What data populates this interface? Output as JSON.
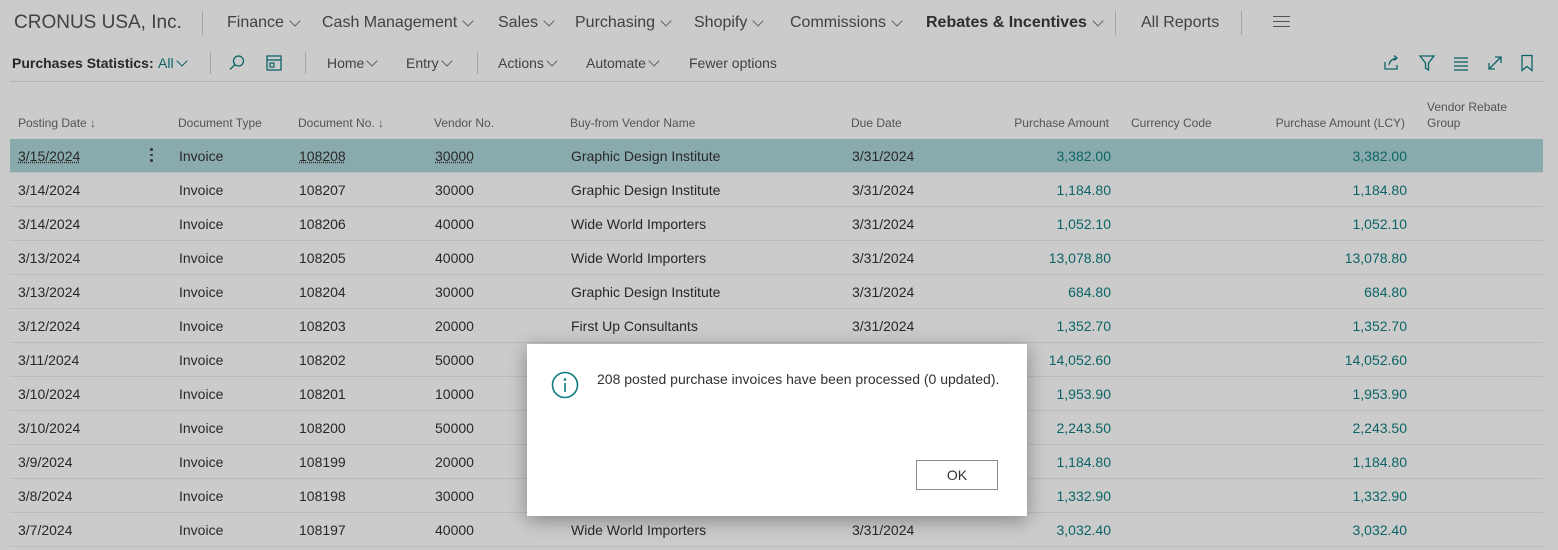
{
  "company": "CRONUS USA, Inc.",
  "nav": {
    "items": [
      "Finance",
      "Cash Management",
      "Sales",
      "Purchasing",
      "Shopify",
      "Commissions",
      "Rebates & Incentives"
    ],
    "all_reports": "All Reports"
  },
  "actionbar": {
    "title": "Purchases Statistics:",
    "filter": "All",
    "home": "Home",
    "entry": "Entry",
    "actions": "Actions",
    "automate": "Automate",
    "fewer": "Fewer options"
  },
  "columns": {
    "posting_date": "Posting Date",
    "document_type": "Document Type",
    "document_no": "Document No.",
    "vendor_no": "Vendor No.",
    "vendor_name": "Buy-from Vendor Name",
    "due_date": "Due Date",
    "purchase_amount": "Purchase Amount",
    "currency_code": "Currency Code",
    "purchase_amount_lcy": "Purchase Amount (LCY)",
    "rebate_group_line1": "Vendor Rebate",
    "rebate_group_line2": "Group"
  },
  "rows": [
    {
      "date": "3/15/2024",
      "type": "Invoice",
      "doc": "108208",
      "vendor": "30000",
      "name": "Graphic Design Institute",
      "due": "3/31/2024",
      "amount": "3,382.00",
      "lcy": "3,382.00"
    },
    {
      "date": "3/14/2024",
      "type": "Invoice",
      "doc": "108207",
      "vendor": "30000",
      "name": "Graphic Design Institute",
      "due": "3/31/2024",
      "amount": "1,184.80",
      "lcy": "1,184.80"
    },
    {
      "date": "3/14/2024",
      "type": "Invoice",
      "doc": "108206",
      "vendor": "40000",
      "name": "Wide World Importers",
      "due": "3/31/2024",
      "amount": "1,052.10",
      "lcy": "1,052.10"
    },
    {
      "date": "3/13/2024",
      "type": "Invoice",
      "doc": "108205",
      "vendor": "40000",
      "name": "Wide World Importers",
      "due": "3/31/2024",
      "amount": "13,078.80",
      "lcy": "13,078.80"
    },
    {
      "date": "3/13/2024",
      "type": "Invoice",
      "doc": "108204",
      "vendor": "30000",
      "name": "Graphic Design Institute",
      "due": "3/31/2024",
      "amount": "684.80",
      "lcy": "684.80"
    },
    {
      "date": "3/12/2024",
      "type": "Invoice",
      "doc": "108203",
      "vendor": "20000",
      "name": "First Up Consultants",
      "due": "3/31/2024",
      "amount": "1,352.70",
      "lcy": "1,352.70"
    },
    {
      "date": "3/11/2024",
      "type": "Invoice",
      "doc": "108202",
      "vendor": "50000",
      "name": "",
      "due": "",
      "amount": "14,052.60",
      "lcy": "14,052.60"
    },
    {
      "date": "3/10/2024",
      "type": "Invoice",
      "doc": "108201",
      "vendor": "10000",
      "name": "",
      "due": "",
      "amount": "1,953.90",
      "lcy": "1,953.90"
    },
    {
      "date": "3/10/2024",
      "type": "Invoice",
      "doc": "108200",
      "vendor": "50000",
      "name": "",
      "due": "",
      "amount": "2,243.50",
      "lcy": "2,243.50"
    },
    {
      "date": "3/9/2024",
      "type": "Invoice",
      "doc": "108199",
      "vendor": "20000",
      "name": "",
      "due": "",
      "amount": "1,184.80",
      "lcy": "1,184.80"
    },
    {
      "date": "3/8/2024",
      "type": "Invoice",
      "doc": "108198",
      "vendor": "30000",
      "name": "",
      "due": "",
      "amount": "1,332.90",
      "lcy": "1,332.90"
    },
    {
      "date": "3/7/2024",
      "type": "Invoice",
      "doc": "108197",
      "vendor": "40000",
      "name": "Wide World Importers",
      "due": "3/31/2024",
      "amount": "3,032.40",
      "lcy": "3,032.40"
    }
  ],
  "dialog": {
    "message": "208 posted purchase invoices have been processed (0 updated).",
    "ok": "OK"
  },
  "colors": {
    "accent": "#0f7b7d",
    "selected_row": "#a9d1d4"
  }
}
